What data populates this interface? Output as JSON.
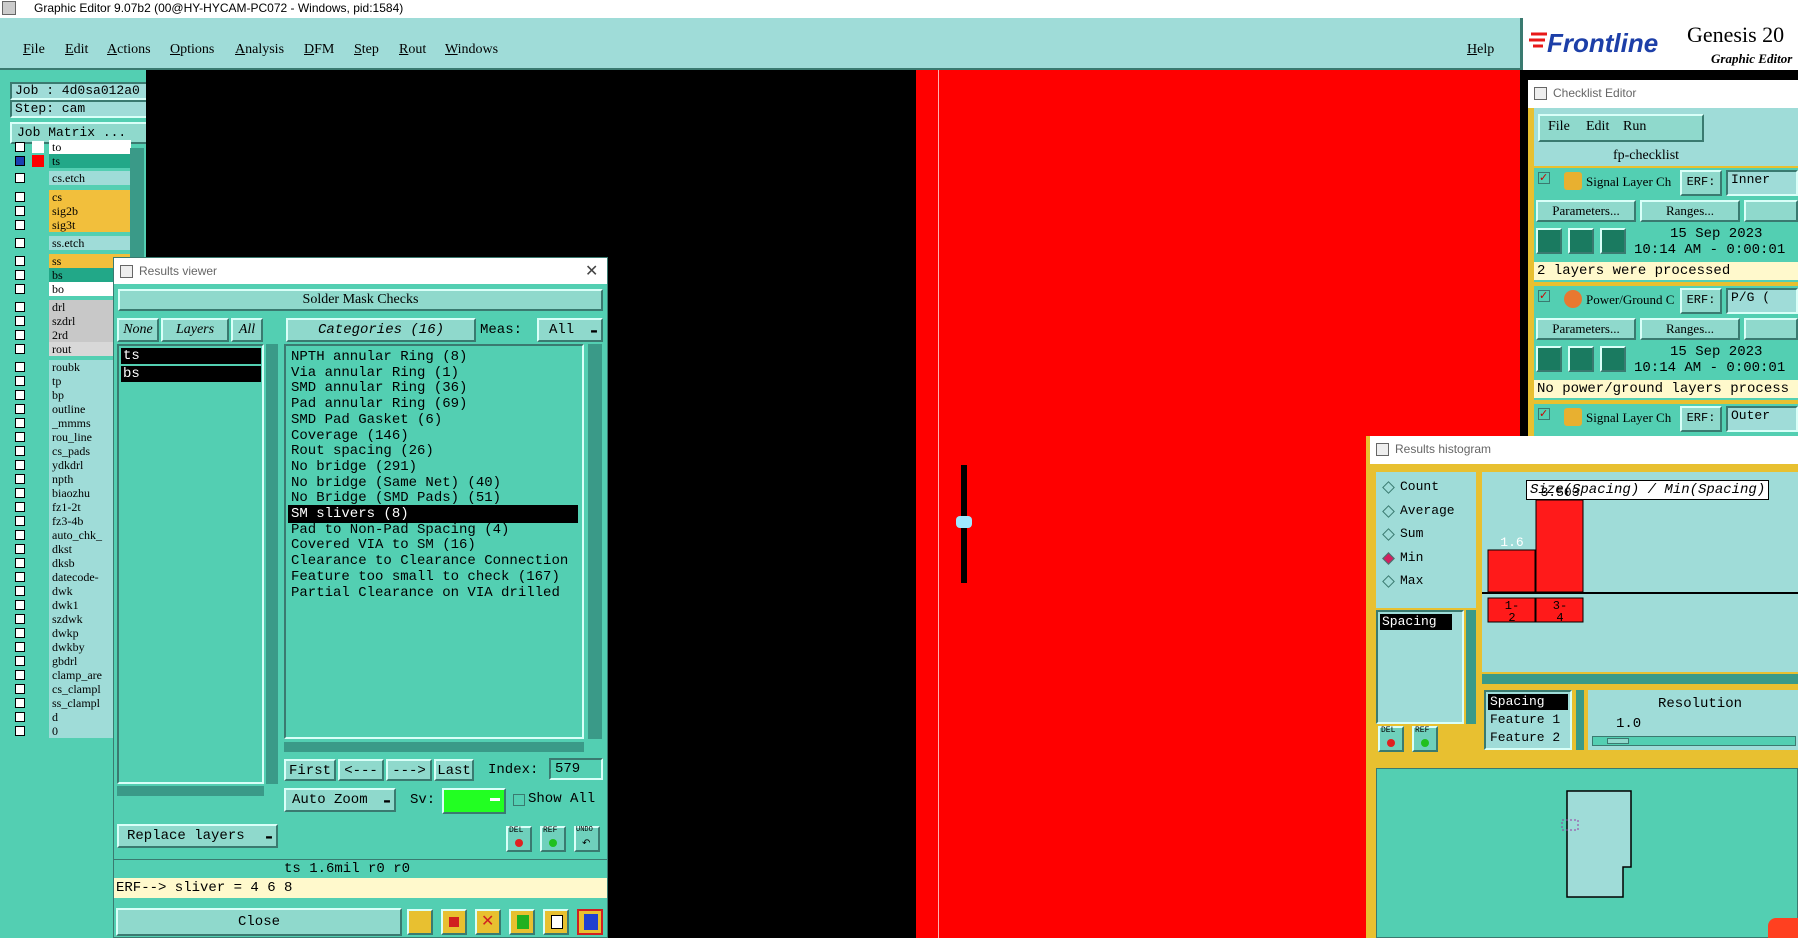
{
  "window": {
    "title": "Graphic Editor 9.07b2 (00@HY-HYCAM-PC072 - Windows, pid:1584)"
  },
  "menu": [
    "File",
    "Edit",
    "Actions",
    "Options",
    "Analysis",
    "DFM",
    "Step",
    "Rout",
    "Windows"
  ],
  "help_label": "Help",
  "logo": {
    "brand": "Frontline",
    "product": "Genesis 20",
    "subtitle": "Graphic Editor"
  },
  "job": {
    "job_label": "Job : 4d0sa012a0",
    "step_label": "Step: cam",
    "matrix_btn": "Job Matrix ..."
  },
  "layers": [
    {
      "name": "to",
      "color": "#ffffff",
      "bg": "#ffffff"
    },
    {
      "name": "ts",
      "color": "#ff0000",
      "bg": "#22a888",
      "selected": true
    },
    {
      "name": "cs.etch",
      "color": "",
      "bg": "#9fdcd8"
    },
    {
      "name": "cs",
      "color": "",
      "bg": "#f2bf3c"
    },
    {
      "name": "sig2b",
      "color": "",
      "bg": "#f2bf3c"
    },
    {
      "name": "sig3t",
      "color": "",
      "bg": "#f2bf3c"
    },
    {
      "name": "ss.etch",
      "color": "",
      "bg": "#9fdcd8"
    },
    {
      "name": "ss",
      "color": "",
      "bg": "#f2bf3c"
    },
    {
      "name": "bs",
      "color": "",
      "bg": "#22a888"
    },
    {
      "name": "bo",
      "color": "",
      "bg": "#ffffff"
    },
    {
      "name": "drl",
      "color": "",
      "bg": "#c8c8c8"
    },
    {
      "name": "szdrl",
      "color": "",
      "bg": "#c8c8c8"
    },
    {
      "name": "2rd",
      "color": "",
      "bg": "#c8c8c8"
    },
    {
      "name": "rout",
      "color": "",
      "bg": "#d8d8d8"
    },
    {
      "name": "roubk",
      "color": "",
      "bg": "#9fdcd8"
    },
    {
      "name": "tp",
      "color": "",
      "bg": "#9fdcd8"
    },
    {
      "name": "bp",
      "color": "",
      "bg": "#9fdcd8"
    },
    {
      "name": "outline",
      "color": "",
      "bg": "#9fdcd8"
    },
    {
      "name": "_mmms",
      "color": "",
      "bg": "#9fdcd8"
    },
    {
      "name": "rou_line",
      "color": "",
      "bg": "#9fdcd8"
    },
    {
      "name": "cs_pads",
      "color": "",
      "bg": "#9fdcd8"
    },
    {
      "name": "ydkdrl",
      "color": "",
      "bg": "#9fdcd8"
    },
    {
      "name": "npth",
      "color": "",
      "bg": "#9fdcd8"
    },
    {
      "name": "biaozhu",
      "color": "",
      "bg": "#9fdcd8"
    },
    {
      "name": "fz1-2t",
      "color": "",
      "bg": "#9fdcd8"
    },
    {
      "name": "fz3-4b",
      "color": "",
      "bg": "#9fdcd8"
    },
    {
      "name": "auto_chk_",
      "color": "",
      "bg": "#9fdcd8"
    },
    {
      "name": "dkst",
      "color": "",
      "bg": "#9fdcd8"
    },
    {
      "name": "dksb",
      "color": "",
      "bg": "#9fdcd8"
    },
    {
      "name": "datecode-",
      "color": "",
      "bg": "#9fdcd8"
    },
    {
      "name": "dwk",
      "color": "",
      "bg": "#9fdcd8"
    },
    {
      "name": "dwk1",
      "color": "",
      "bg": "#9fdcd8"
    },
    {
      "name": "szdwk",
      "color": "",
      "bg": "#9fdcd8"
    },
    {
      "name": "dwkp",
      "color": "",
      "bg": "#9fdcd8"
    },
    {
      "name": "dwkby",
      "color": "",
      "bg": "#9fdcd8"
    },
    {
      "name": "gbdrl",
      "color": "",
      "bg": "#9fdcd8"
    },
    {
      "name": "clamp_are",
      "color": "",
      "bg": "#9fdcd8"
    },
    {
      "name": "cs_clampl",
      "color": "",
      "bg": "#9fdcd8"
    },
    {
      "name": "ss_clampl",
      "color": "",
      "bg": "#9fdcd8"
    },
    {
      "name": "d",
      "color": "",
      "bg": "#9fdcd8"
    },
    {
      "name": "0",
      "color": "",
      "bg": "#9fdcd8"
    }
  ],
  "results_viewer": {
    "title": "Results viewer",
    "heading": "Solder Mask Checks",
    "none_btn": "None",
    "layers_btn": "Layers",
    "all_btn": "All",
    "categories_btn": "Categories (16)",
    "meas_label": "Meas:",
    "meas_value": "All",
    "layer_list": [
      "ts",
      "bs"
    ],
    "categories": [
      "NPTH annular Ring (8)",
      "Via annular Ring (1)",
      "SMD annular Ring (36)",
      "Pad annular Ring (69)",
      "SMD Pad Gasket (6)",
      "Coverage (146)",
      "Rout spacing (26)",
      "No bridge (291)",
      "No bridge (Same Net) (40)",
      "No Bridge (SMD Pads) (51)",
      "SM slivers (8)",
      "Pad to Non-Pad Spacing (4)",
      "Covered VIA to SM (16)",
      "Clearance to Clearance Connection",
      "Feature too small to check (167)",
      "Partial Clearance on VIA drilled"
    ],
    "selected_category": 10,
    "nav": {
      "first": "First",
      "prev": "<---",
      "next": "--->",
      "last": "Last",
      "index_label": "Index:",
      "index_value": "579"
    },
    "auto_zoom": "Auto Zoom",
    "sv_label": "Sv:",
    "show_all": "Show All",
    "replace_layers": "Replace layers",
    "del": "DEL",
    "ref": "REF",
    "undo": "UNDO",
    "status_line": "ts 1.6mil  r0  r0",
    "erf_line": "ERF--> sliver = 4 6 8",
    "close": "Close"
  },
  "checklist": {
    "title": "Checklist Editor",
    "menu": [
      "File",
      "Edit",
      "Run"
    ],
    "name": "fp-checklist",
    "items": [
      {
        "label": "Signal Layer Ch",
        "erf": "ERF:",
        "erf_value": "Inner",
        "date": "15 Sep 2023",
        "time": "10:14 AM - 0:00:01",
        "status": "2 layers were processed"
      },
      {
        "label": "Power/Ground C",
        "erf": "ERF:",
        "erf_value": "P/G (",
        "date": "15 Sep 2023",
        "time": "10:14 AM - 0:00:01",
        "status": "No power/ground layers process"
      },
      {
        "label": "Signal Layer Ch",
        "erf": "ERF:",
        "erf_value": "Outer",
        "date": "",
        "time": "",
        "status": ""
      }
    ],
    "params_btn": "Parameters...",
    "ranges_btn": "Ranges..."
  },
  "histogram": {
    "title": "Results histogram",
    "modes": [
      "Count",
      "Average",
      "Sum",
      "Min",
      "Max"
    ],
    "selected_mode": "Min",
    "list_item": "Spacing",
    "chart_title": "Size(Spacing) / Min(Spacing)",
    "bars": [
      {
        "label": "1-2",
        "value": 1.6,
        "value_text": "1.6"
      },
      {
        "label": "3-4",
        "value": 3.503,
        "value_text": "3.503"
      }
    ],
    "fields": [
      "Spacing",
      "Feature 1",
      "Feature 2"
    ],
    "resolution_label": "Resolution",
    "resolution_value": "1.0",
    "del": "DEL",
    "ref": "REF"
  },
  "colors": {
    "teal": "#53cfb2",
    "light_teal": "#9fdcd8",
    "red": "#ff0000",
    "yellow": "#e8c030"
  }
}
